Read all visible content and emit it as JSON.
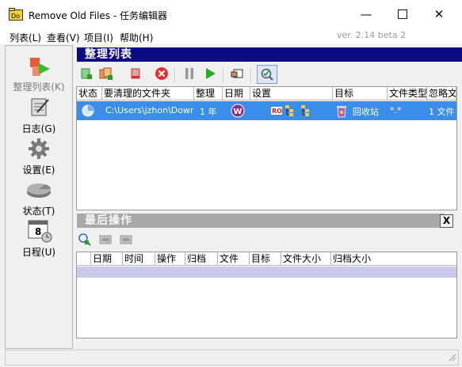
{
  "window": {
    "title": "Remove Old Files - 任务编辑器"
  },
  "menu": {
    "items": [
      "列表(L)",
      "查看(V)",
      "项目(I)",
      "帮助(H)"
    ],
    "version": "ver. 2.14 beta 2"
  },
  "nav": {
    "items": [
      {
        "label": "整理列表(K)",
        "icon": "cleanup-list-icon",
        "active": true
      },
      {
        "label": "日志(G)",
        "icon": "log-notebook-icon"
      },
      {
        "label": "设置(E)",
        "icon": "settings-gear-icon"
      },
      {
        "label": "状态(T)",
        "icon": "status-disk-icon"
      },
      {
        "label": "日程(U)",
        "icon": "calendar-icon"
      }
    ]
  },
  "cleanup_panel": {
    "title": "整理列表",
    "columns": [
      "状态",
      "要清理的文件夹",
      "整理",
      "日期",
      "设置",
      "目标",
      "文件类型",
      "忽略文"
    ],
    "rows": [
      {
        "folder": "C:\\Users\\jzhon\\Downloads",
        "cleanup": "1 年",
        "target": "回收站",
        "filetypes": "*.*",
        "ignore": "1 文件"
      }
    ]
  },
  "operations_panel": {
    "title": "最后操作",
    "close_label": "X",
    "columns": [
      "日期",
      "时间",
      "操作",
      "归档",
      "文件",
      "目标",
      "文件大小",
      "归档大小"
    ]
  },
  "colors": {
    "accent": "#0b0b80",
    "selection": "#3b8ee8"
  }
}
